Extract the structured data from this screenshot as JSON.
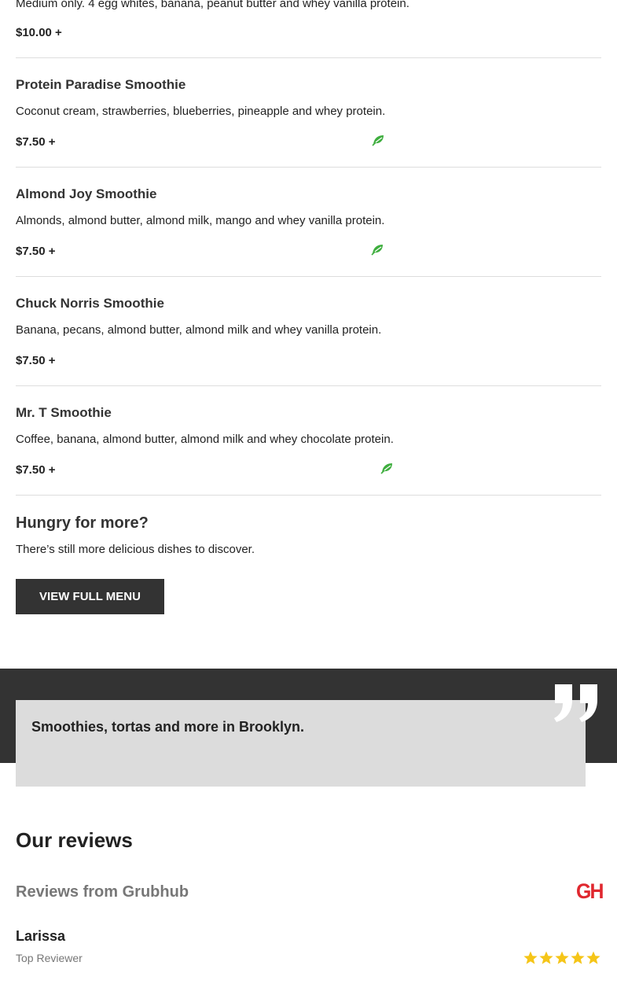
{
  "menu": {
    "top_item": {
      "description": "Medium only. 4 egg whites, banana, peanut butter and whey vanilla protein.",
      "price": "$10.00 +"
    },
    "items": [
      {
        "name": "Protein Paradise Smoothie",
        "description": "Coconut cream, strawberries, blueberries, pineapple and whey protein.",
        "price": "$7.50 +",
        "icon": "leaf-icon"
      },
      {
        "name": "Almond Joy Smoothie",
        "description": "Almonds, almond butter, almond milk, mango and whey vanilla protein.",
        "price": "$7.50 +",
        "icon": "leaf-icon"
      },
      {
        "name": "Chuck Norris Smoothie",
        "description": "Banana, pecans, almond butter, almond milk and whey vanilla protein.",
        "price": "$7.50 +"
      },
      {
        "name": "Mr. T Smoothie",
        "description": "Coffee, banana, almond butter, almond milk and whey chocolate protein.",
        "price": "$7.50 +",
        "icon": "leaf-icon"
      }
    ]
  },
  "more": {
    "title": "Hungry for more?",
    "subtitle": "There’s still more delicious dishes to discover.",
    "button_label": "VIEW FULL MENU"
  },
  "quote": {
    "text": "Smoothies, tortas and more in Brooklyn.",
    "icon": "quote-icon"
  },
  "reviews": {
    "title": "Our reviews",
    "source": "Reviews from Grubhub",
    "source_logo": "GH",
    "reviewer": {
      "name": "Larissa",
      "badge": "Top Reviewer",
      "rating": 5,
      "rating_max": 5
    }
  },
  "colors": {
    "leaf": "#3fae3f",
    "button_bg": "#333333",
    "band": "#333333",
    "quote_card": "#dcdcdc",
    "star": "#f5c518",
    "grubhub": "#e0282f"
  }
}
